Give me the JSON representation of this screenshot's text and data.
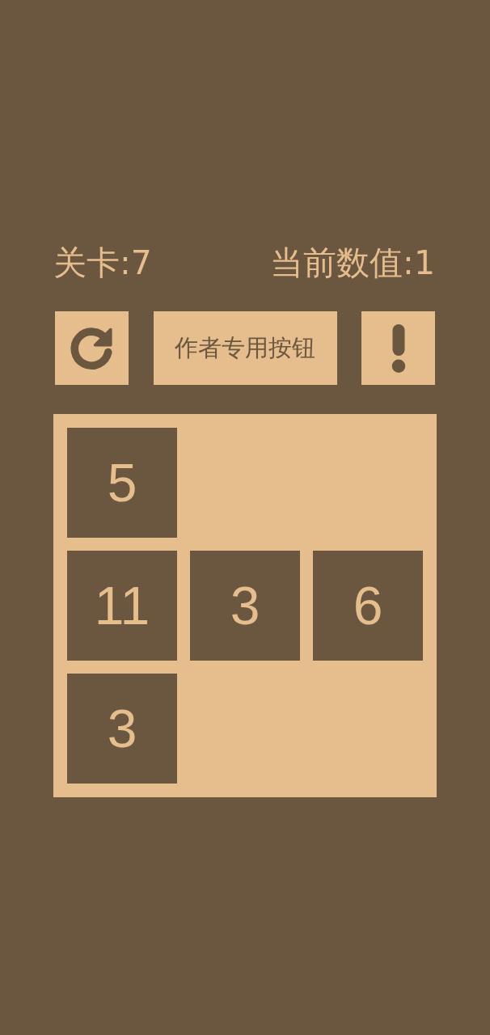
{
  "header": {
    "level_label": "关卡:7",
    "current_value_label": "当前数值:1"
  },
  "toolbar": {
    "author_button": "作者专用按钮"
  },
  "board": {
    "rows": [
      [
        {
          "kind": "tile",
          "value": "5"
        },
        {
          "kind": "empty"
        },
        {
          "kind": "empty"
        }
      ],
      [
        {
          "kind": "tile",
          "value": "11"
        },
        {
          "kind": "tile",
          "value": "3"
        },
        {
          "kind": "tile",
          "value": "6"
        }
      ],
      [
        {
          "kind": "tile",
          "value": "3"
        },
        {
          "kind": "empty"
        },
        {
          "kind": "empty"
        }
      ]
    ]
  }
}
